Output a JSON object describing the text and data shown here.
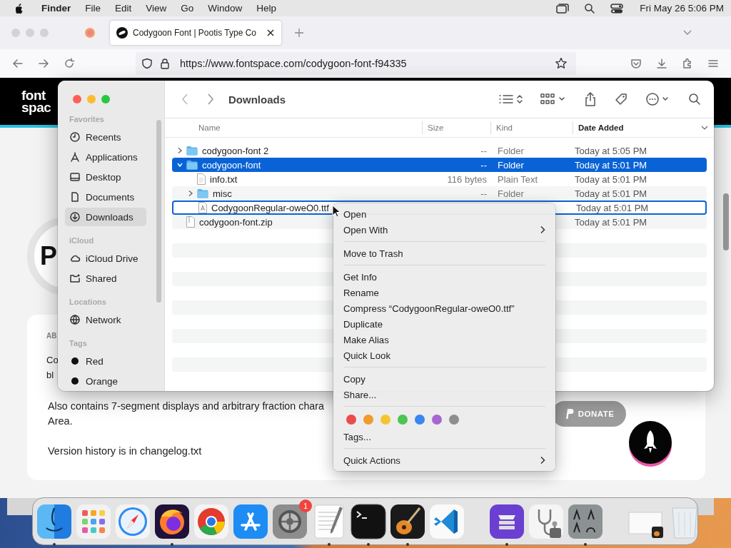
{
  "menubar": {
    "app": "Finder",
    "menus": [
      "File",
      "Edit",
      "View",
      "Go",
      "Window",
      "Help"
    ],
    "clock": "Fri May 26  5:06 PM"
  },
  "browser": {
    "tabs": [
      {
        "title": "Codygoon Font | Pootis Type Co",
        "selected": true
      }
    ],
    "url": "https://www.fontspace.com/codygoon-font-f94335"
  },
  "page": {
    "logo": [
      "font",
      "spac"
    ],
    "badge_letter": "P",
    "fragments": [
      "AB",
      "Co",
      "bl"
    ],
    "lines": [
      "Also contains 7-segment displays and arbitrary fraction chara",
      "Area.",
      "Version history is in changelog.txt"
    ],
    "donate": "DONATE"
  },
  "finder": {
    "title": "Downloads",
    "sidebar": [
      {
        "heading": "Favorites",
        "items": [
          {
            "label": "Recents",
            "kind": "clock",
            "selected": false
          },
          {
            "label": "Applications",
            "kind": "apps",
            "selected": false
          },
          {
            "label": "Desktop",
            "kind": "desktop",
            "selected": false
          },
          {
            "label": "Documents",
            "kind": "document",
            "selected": false
          },
          {
            "label": "Downloads",
            "kind": "download",
            "selected": true
          }
        ]
      },
      {
        "heading": "iCloud",
        "items": [
          {
            "label": "iCloud Drive",
            "kind": "cloud",
            "selected": false
          },
          {
            "label": "Shared",
            "kind": "shared",
            "selected": false
          }
        ]
      },
      {
        "heading": "Locations",
        "items": [
          {
            "label": "Network",
            "kind": "network",
            "selected": false
          }
        ]
      },
      {
        "heading": "Tags",
        "items": [
          {
            "label": "Red",
            "kind": "tag",
            "selected": false
          },
          {
            "label": "Orange",
            "kind": "tag",
            "selected": false
          }
        ]
      }
    ],
    "columns": [
      {
        "label": "Name",
        "sorted": false
      },
      {
        "label": "Size",
        "sorted": false
      },
      {
        "label": "Kind",
        "sorted": false
      },
      {
        "label": "Date Added",
        "sorted": true
      }
    ],
    "rows": [
      {
        "name": "codygoon-font 2",
        "kind": "folder",
        "size": "--",
        "file_kind": "Folder",
        "date": "Today at 5:05 PM",
        "expanded": false,
        "selected": false,
        "focused": false
      },
      {
        "name": "codygoon-font",
        "kind": "folder",
        "size": "--",
        "file_kind": "Folder",
        "date": "Today at 5:01 PM",
        "expanded": true,
        "selected": true,
        "focused": false,
        "children": [
          {
            "name": "info.txt",
            "kind": "text",
            "size": "116 bytes",
            "file_kind": "Plain Text",
            "date": "Today at 5:01 PM",
            "selected": false,
            "focused": false
          },
          {
            "name": "misc",
            "kind": "folder",
            "size": "--",
            "file_kind": "Folder",
            "date": "Today at 5:01 PM",
            "expanded": false,
            "selected": false,
            "focused": false
          },
          {
            "name": "CodygoonRegular-oweO0.ttf",
            "kind": "font",
            "date": "Today at 5:01 PM",
            "selected": false,
            "focused": true
          }
        ]
      },
      {
        "name": "codygoon-font.zip",
        "kind": "archive",
        "date": "Today at 5:01 PM",
        "selected": false,
        "focused": false
      }
    ]
  },
  "context_menu": {
    "items": [
      {
        "kind": "item",
        "label": "Open",
        "submenu": false
      },
      {
        "kind": "item",
        "label": "Open With",
        "submenu": true
      },
      {
        "kind": "separator"
      },
      {
        "kind": "item",
        "label": "Move to Trash",
        "submenu": false
      },
      {
        "kind": "separator"
      },
      {
        "kind": "item",
        "label": "Get Info",
        "submenu": false
      },
      {
        "kind": "item",
        "label": "Rename",
        "submenu": false
      },
      {
        "kind": "item",
        "label": "Compress “CodygoonRegular-oweO0.ttf”",
        "submenu": false
      },
      {
        "kind": "item",
        "label": "Duplicate",
        "submenu": false
      },
      {
        "kind": "item",
        "label": "Make Alias",
        "submenu": false
      },
      {
        "kind": "item",
        "label": "Quick Look",
        "submenu": false
      },
      {
        "kind": "separator"
      },
      {
        "kind": "item",
        "label": "Copy",
        "submenu": false
      },
      {
        "kind": "item",
        "label": "Share...",
        "submenu": false
      },
      {
        "kind": "separator"
      },
      {
        "kind": "colors",
        "tags": [
          {
            "color": "#ec4b4b"
          },
          {
            "color": "#f09a30"
          },
          {
            "color": "#f5c531"
          },
          {
            "color": "#4cc552"
          },
          {
            "color": "#3a86f0"
          },
          {
            "color": "#a767d2"
          },
          {
            "color": "#8e8e8e"
          }
        ]
      },
      {
        "kind": "item",
        "label": "Tags...",
        "submenu": false
      },
      {
        "kind": "separator"
      },
      {
        "kind": "item",
        "label": "Quick Actions",
        "submenu": true
      }
    ]
  },
  "dock": {
    "items": [
      {
        "kind": "finder",
        "running": true
      },
      {
        "kind": "launchpad",
        "running": false
      },
      {
        "kind": "safari",
        "running": false
      },
      {
        "kind": "firefox",
        "running": true
      },
      {
        "kind": "chrome",
        "running": false
      },
      {
        "kind": "appstore",
        "running": false
      },
      {
        "kind": "settings",
        "running": false,
        "badge": "1"
      },
      {
        "kind": "textedit",
        "running": true
      },
      {
        "kind": "terminal",
        "running": true
      },
      {
        "kind": "guitar",
        "running": true
      },
      {
        "kind": "code",
        "running": false
      },
      {
        "kind": "divider"
      },
      {
        "kind": "disk",
        "running": true
      },
      {
        "kind": "doctor",
        "running": false
      },
      {
        "kind": "fontbook",
        "running": true
      },
      {
        "kind": "divider"
      },
      {
        "kind": "window",
        "running": false
      },
      {
        "kind": "trash",
        "running": false
      }
    ]
  }
}
